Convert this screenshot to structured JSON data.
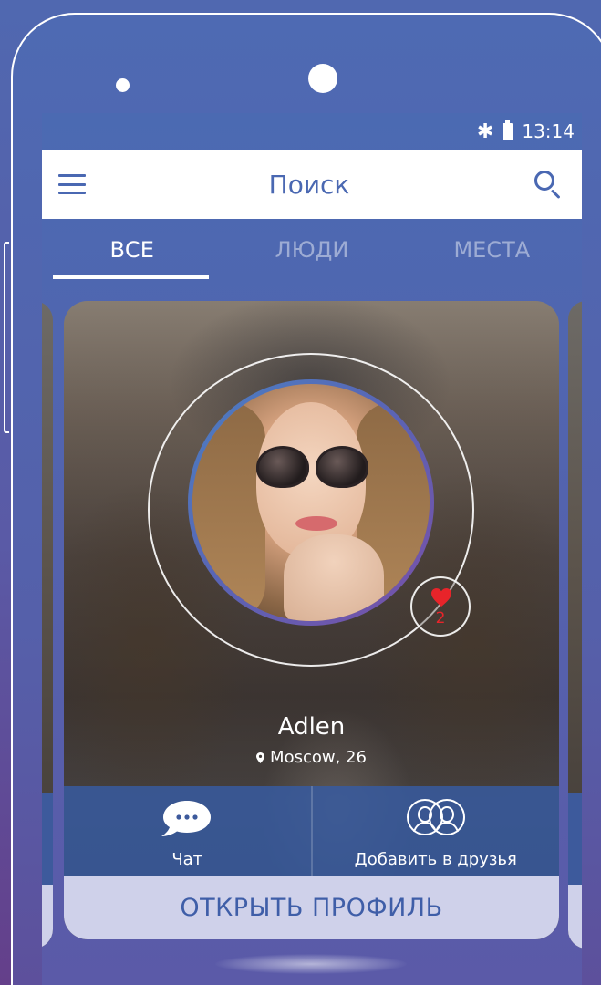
{
  "status_bar": {
    "time": "13:14",
    "bluetooth_icon": "bluetooth-icon",
    "battery_icon": "battery-icon"
  },
  "app_bar": {
    "title": "Поиск",
    "menu_icon": "hamburger-menu-icon",
    "search_icon": "search-icon"
  },
  "tabs": [
    {
      "label": "ВСЕ",
      "active": true
    },
    {
      "label": "ЛЮДИ",
      "active": false
    },
    {
      "label": "МЕСТА",
      "active": false
    }
  ],
  "profile_card": {
    "name": "Adlen",
    "location": "Moscow, 26",
    "likes_count": "2",
    "actions": {
      "chat_label": "Чат",
      "add_friend_label": "Добавить в друзья"
    },
    "open_profile_label": "ОТКРЫТЬ ПРОФИЛЬ"
  },
  "colors": {
    "primary": "#4a68b2",
    "background_gradient_end": "#643f8a",
    "action_bar": "#375aa0",
    "open_profile_bg": "#cfd1ea",
    "heart": "#e8242a"
  }
}
